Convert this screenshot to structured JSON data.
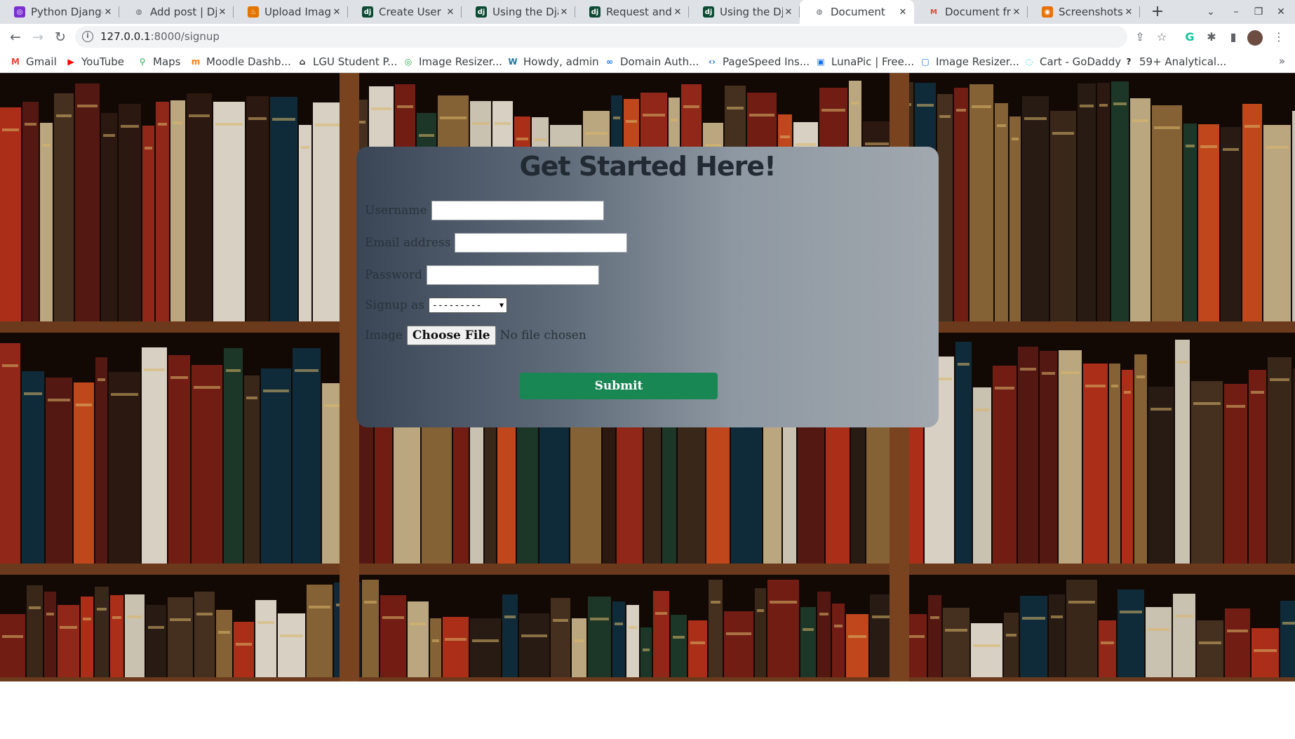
{
  "browser": {
    "tabs": [
      {
        "title": "Python Django",
        "icon": "python-icon",
        "color": "#7b2fd1"
      },
      {
        "title": "Add post | Dja",
        "icon": "globe-icon",
        "color": "#5f6368"
      },
      {
        "title": "Upload Image",
        "icon": "upload-icon",
        "color": "#e37400"
      },
      {
        "title": "Create User M",
        "icon": "django-icon",
        "color": "#0c4b33"
      },
      {
        "title": "Using the Djan",
        "icon": "django-icon",
        "color": "#0c4b33"
      },
      {
        "title": "Request and re",
        "icon": "django-icon",
        "color": "#0c4b33"
      },
      {
        "title": "Using the Djan",
        "icon": "django-icon",
        "color": "#0c4b33"
      },
      {
        "title": "Document",
        "icon": "globe-icon",
        "color": "#5f6368",
        "active": true
      },
      {
        "title": "Document fro",
        "icon": "gmail-icon",
        "color": "#ea4335"
      },
      {
        "title": "Screenshots a",
        "icon": "screenshot-icon",
        "color": "#e8710a"
      }
    ],
    "url": {
      "host": "127.0.0.1",
      "path": ":8000/signup"
    },
    "bookmarks": [
      {
        "label": "Gmail",
        "icon": "gmail-icon",
        "color": "#ea4335"
      },
      {
        "label": "YouTube",
        "icon": "youtube-icon",
        "color": "#ff0000"
      },
      {
        "label": "Maps",
        "icon": "maps-icon",
        "color": "#34a853"
      },
      {
        "label": "Moodle Dashb...",
        "icon": "moodle-icon",
        "color": "#f98012"
      },
      {
        "label": "LGU Student P...",
        "icon": "home-icon",
        "color": "#202124"
      },
      {
        "label": "Image Resizer...",
        "icon": "image-resizer-icon",
        "color": "#34a853"
      },
      {
        "label": "Howdy, admin",
        "icon": "wordpress-icon",
        "color": "#21759b"
      },
      {
        "label": "Domain Auth...",
        "icon": "link-icon",
        "color": "#1a73e8"
      },
      {
        "label": "PageSpeed Ins...",
        "icon": "pagespeed-icon",
        "color": "#1a73e8"
      },
      {
        "label": "LunaPic | Free...",
        "icon": "lunapic-icon",
        "color": "#1a73e8"
      },
      {
        "label": "Image Resizer...",
        "icon": "image-icon",
        "color": "#1a73e8"
      },
      {
        "label": "Cart - GoDaddy",
        "icon": "godaddy-icon",
        "color": "#1bdbdb"
      },
      {
        "label": "59+ Analytical...",
        "icon": "question-icon",
        "color": "#202124"
      }
    ]
  },
  "form": {
    "title": "Get Started Here!",
    "username_label": "Username",
    "email_label": "Email address",
    "password_label": "Password",
    "signup_as_label": "Signup as",
    "signup_as_value": "---------",
    "image_label": "Image",
    "choose_file_label": "Choose File",
    "file_status": "No file chosen",
    "submit_label": "Submit",
    "submit_color": "#198754"
  }
}
